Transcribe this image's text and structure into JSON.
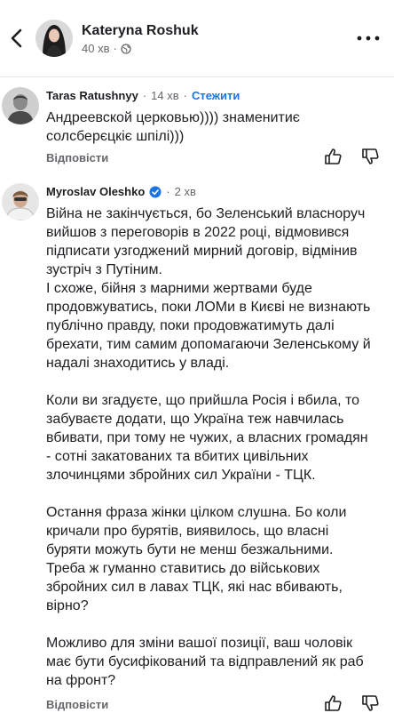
{
  "header": {
    "author_name": "Kateryna Roshuk",
    "post_time": "40 хв",
    "icons": {
      "back": "back-chevron-icon",
      "privacy": "globe-icon",
      "more": "more-dots-icon"
    }
  },
  "comments": [
    {
      "author": "Taras Ratushnyy",
      "time": "14 хв",
      "follow_label": "Стежити",
      "lines": [
        "Андреевской церковью)))) знаменитиє",
        "солсберєцкіє шпілі)))"
      ],
      "reply_label": "Відповісти"
    },
    {
      "author": "Myroslav Oleshko",
      "time": "2 хв",
      "verified": true,
      "paragraphs": [
        [
          "Війна не закінчується, бо Зеленський власноруч",
          "вийшов з переговорів в 2022 році, відмовився",
          "підписати узгоджений мирний договір, відмінив",
          "зустріч з Путіним.",
          "І схоже, бійня з марними жертвами буде",
          "продовжуватись, поки ЛОМи в Києві не визнають",
          "публічно правду, поки продовжатимуть далі",
          "брехати, тим самим допомагаючи Зеленському й",
          "надалі знаходитись у владі."
        ],
        [
          "Коли ви згадуєте, що прийшла Росія і вбила, то",
          "забуваєте додати, що Україна теж навчилась",
          "вбивати, при тому не чужих, а власних громадян",
          "- сотні закатованих та вбитих цивільних",
          "злочинцями збройних сил України - ТЦК."
        ],
        [
          "Остання фраза жінки цілком слушна. Бо коли",
          "кричали про бурятів, виявилось, що власні",
          "буряти можуть бути не менш безжальними.",
          "Треба ж гуманно ставитись до військових",
          "збройних сил в лавах ТЦК, які нас вбивають,",
          "вірно?"
        ],
        [
          "Можливо для зміни вашої позиції, ваш чоловік",
          "має бути бусифікований та відправлений як раб",
          "на фронт?"
        ]
      ],
      "reply_label": "Відповісти"
    }
  ],
  "colors": {
    "link_blue": "#1b74e4",
    "meta_gray": "#65676b",
    "text": "#1c1e21"
  }
}
